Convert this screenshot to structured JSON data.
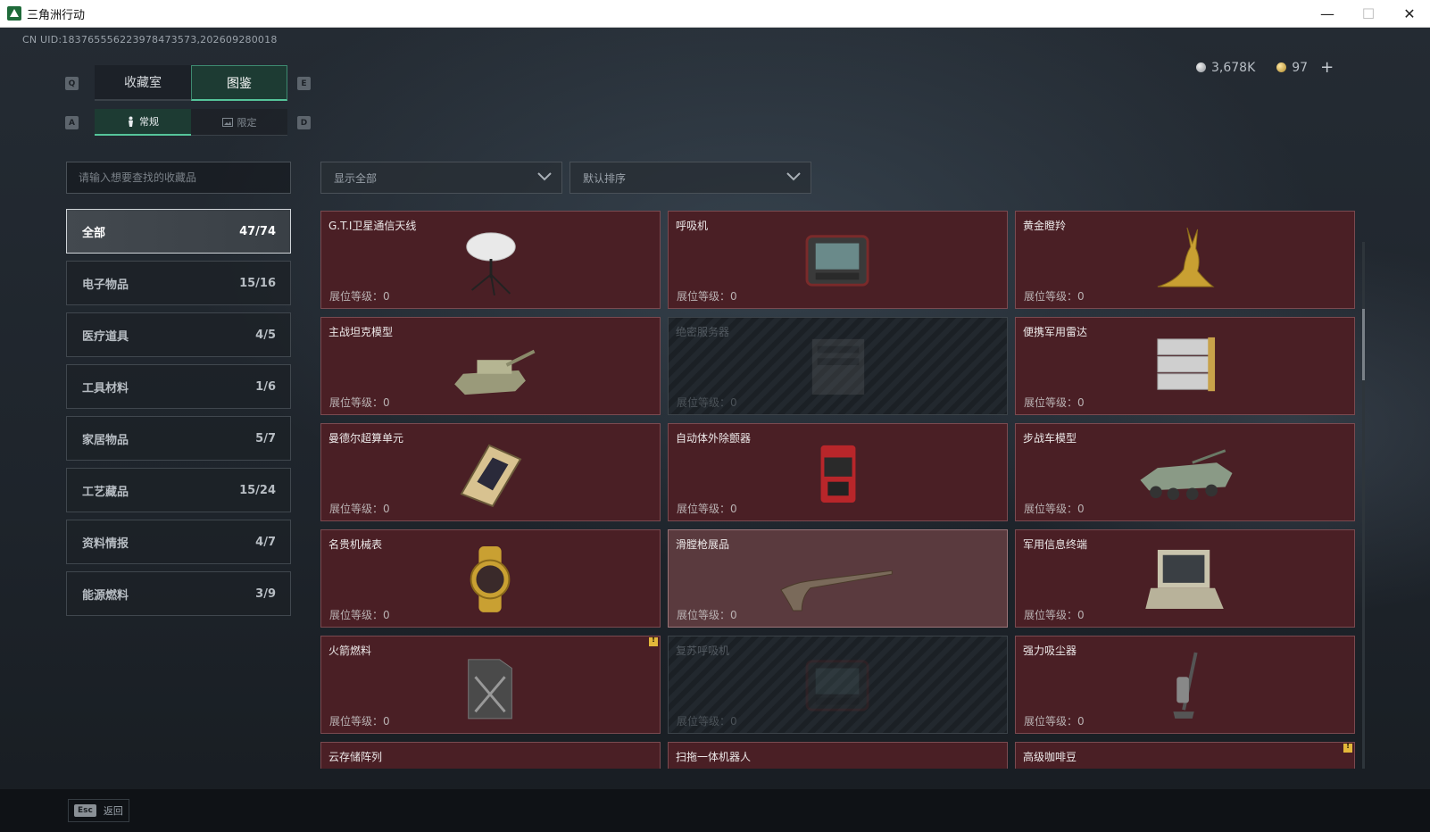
{
  "window": {
    "title": "三角洲行动",
    "minimize": "—",
    "maximize": "☐",
    "close": "✕"
  },
  "uid": "CN UID:183765556223978473573,202609280018",
  "currency": {
    "silver": "3,678K",
    "gold": "97",
    "add": "+"
  },
  "keys": {
    "prev_tab": "Q",
    "next_tab": "E",
    "prev_sub": "A",
    "next_sub": "D"
  },
  "tabs": [
    {
      "label": "收藏室"
    },
    {
      "label": "图鉴"
    }
  ],
  "sub_tabs": [
    {
      "label": "常规",
      "icon": "figure-icon"
    },
    {
      "label": "限定",
      "icon": "image-icon"
    }
  ],
  "search": {
    "placeholder": "请输入想要查找的收藏品",
    "value": ""
  },
  "filter": {
    "selected": "显示全部"
  },
  "sort": {
    "selected": "默认排序"
  },
  "categories": [
    {
      "name": "全部",
      "count": "47/74"
    },
    {
      "name": "电子物品",
      "count": "15/16"
    },
    {
      "name": "医疗道具",
      "count": "4/5"
    },
    {
      "name": "工具材料",
      "count": "1/6"
    },
    {
      "name": "家居物品",
      "count": "5/7"
    },
    {
      "name": "工艺藏品",
      "count": "15/24"
    },
    {
      "name": "资料情报",
      "count": "4/7"
    },
    {
      "name": "能源燃料",
      "count": "3/9"
    }
  ],
  "items": [
    {
      "name": "G.T.I卫星通信天线",
      "level": "展位等级：0",
      "icon": "satellite-dish-icon",
      "state": "owned"
    },
    {
      "name": "呼吸机",
      "level": "展位等级：0",
      "icon": "ventilator-icon",
      "state": "owned"
    },
    {
      "name": "黄金瞪羚",
      "level": "展位等级：0",
      "icon": "golden-gazelle-icon",
      "state": "owned"
    },
    {
      "name": "主战坦克模型",
      "level": "展位等级：0",
      "icon": "tank-model-icon",
      "state": "owned"
    },
    {
      "name": "绝密服务器",
      "level": "展位等级：0",
      "icon": "server-icon",
      "state": "locked"
    },
    {
      "name": "便携军用雷达",
      "level": "展位等级：0",
      "icon": "radar-icon",
      "state": "owned"
    },
    {
      "name": "曼德尔超算单元",
      "level": "展位等级：0",
      "icon": "compute-unit-icon",
      "state": "owned"
    },
    {
      "name": "自动体外除颤器",
      "level": "展位等级：0",
      "icon": "defibrillator-icon",
      "state": "owned"
    },
    {
      "name": "步战车模型",
      "level": "展位等级：0",
      "icon": "ifv-model-icon",
      "state": "owned"
    },
    {
      "name": "名贵机械表",
      "level": "展位等级：0",
      "icon": "watch-icon",
      "state": "owned"
    },
    {
      "name": "滑膛枪展品",
      "level": "展位等级：0",
      "icon": "musket-icon",
      "state": "highlight"
    },
    {
      "name": "军用信息终端",
      "level": "展位等级：0",
      "icon": "terminal-icon",
      "state": "owned"
    },
    {
      "name": "火箭燃料",
      "level": "展位等级：0",
      "icon": "fuel-can-icon",
      "state": "owned",
      "flag": true
    },
    {
      "name": "复苏呼吸机",
      "level": "展位等级：0",
      "icon": "ventilator-icon",
      "state": "locked"
    },
    {
      "name": "强力吸尘器",
      "level": "展位等级：0",
      "icon": "vacuum-icon",
      "state": "owned"
    },
    {
      "name": "云存储阵列",
      "level": "",
      "icon": "storage-array-icon",
      "state": "owned"
    },
    {
      "name": "扫拖一体机器人",
      "level": "",
      "icon": "robot-vacuum-icon",
      "state": "owned"
    },
    {
      "name": "高级咖啡豆",
      "level": "",
      "icon": "coffee-beans-icon",
      "state": "owned",
      "flag": true
    }
  ],
  "footer": {
    "key": "Esc",
    "label": "返回"
  }
}
